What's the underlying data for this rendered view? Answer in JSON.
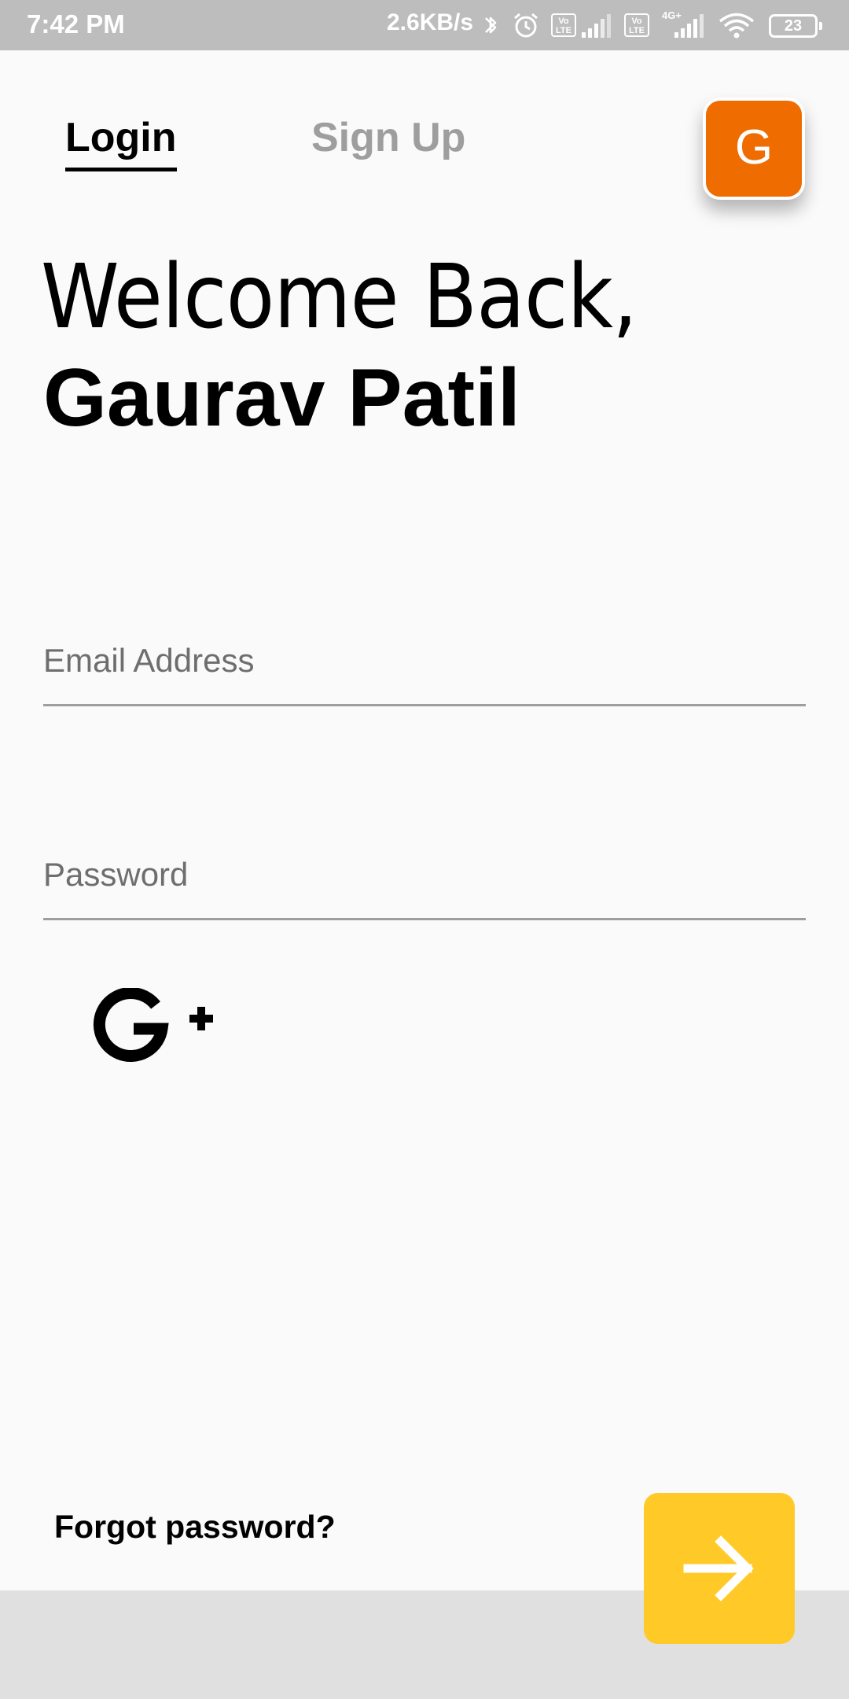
{
  "status_bar": {
    "time": "7:42 PM",
    "net_speed": "2.6KB/s",
    "volte1": "Vo LTE",
    "volte2": "Vo LTE",
    "network": "4G+",
    "battery": "23",
    "icons": [
      "bluetooth-icon",
      "alarm-icon",
      "volte-icon",
      "signal-icon",
      "volte-icon",
      "signal-4g-icon",
      "wifi-icon",
      "battery-icon"
    ]
  },
  "tabs": [
    {
      "label": "Login",
      "active": true
    },
    {
      "label": "Sign Up",
      "active": false
    }
  ],
  "avatar": {
    "initial": "G",
    "color": "#ef6c00"
  },
  "greeting": {
    "line1": "Welcome Back,",
    "name": "Gaurav Patil"
  },
  "form": {
    "email_placeholder": "Email Address",
    "password_placeholder": "Password",
    "social_icon": "google-plus-icon"
  },
  "footer": {
    "forgot_label": "Forgot password?",
    "next_icon": "arrow-right-icon",
    "next_color": "#ffca28"
  }
}
